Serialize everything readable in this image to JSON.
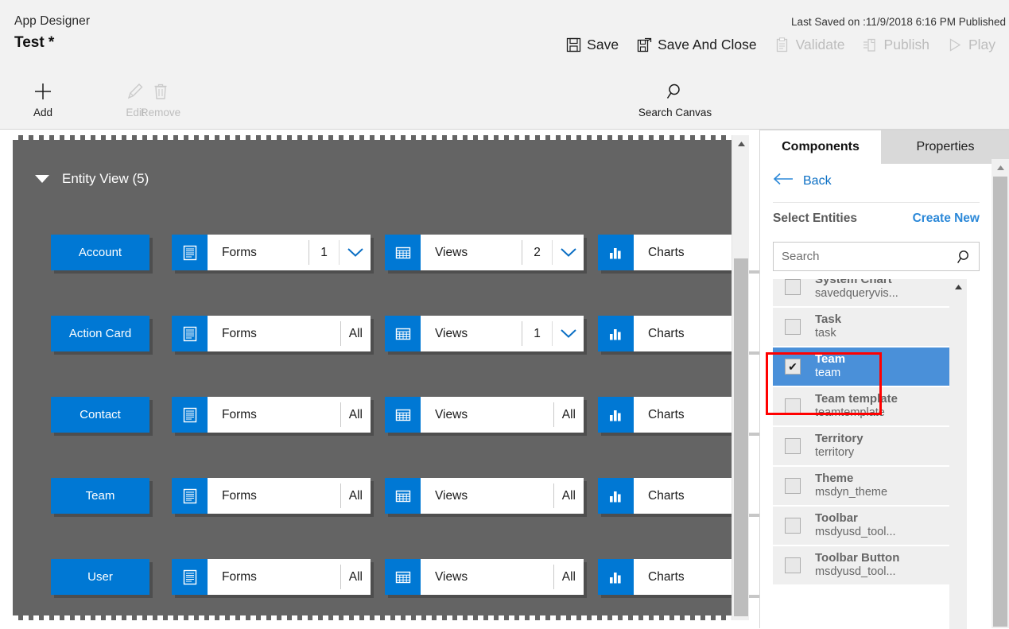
{
  "header": {
    "app_designer_label": "App Designer",
    "app_name": "Test *",
    "last_saved": "Last Saved on :11/9/2018 6:16 PM Published",
    "commands": [
      {
        "label": "Save",
        "icon": "save-icon",
        "disabled": false
      },
      {
        "label": "Save And Close",
        "icon": "save-and-close-icon",
        "disabled": false
      },
      {
        "label": "Validate",
        "icon": "validate-icon",
        "disabled": true
      },
      {
        "label": "Publish",
        "icon": "publish-icon",
        "disabled": true
      },
      {
        "label": "Play",
        "icon": "play-icon",
        "disabled": true
      }
    ]
  },
  "ribbon": {
    "add_label": "Add",
    "edit_label": "Edit",
    "remove_label": "Remove",
    "search_canvas_label": "Search Canvas"
  },
  "canvas": {
    "section_title": "Entity View (5)",
    "forms_label": "Forms",
    "views_label": "Views",
    "charts_label": "Charts",
    "rows": [
      {
        "entity": "Account",
        "forms_count": "1",
        "forms_has_chevron": true,
        "views_count": "2",
        "views_has_chevron": true,
        "charts_count": ""
      },
      {
        "entity": "Action Card",
        "forms_count": "All",
        "forms_has_chevron": false,
        "views_count": "1",
        "views_has_chevron": true,
        "charts_count": ""
      },
      {
        "entity": "Contact",
        "forms_count": "All",
        "forms_has_chevron": false,
        "views_count": "All",
        "views_has_chevron": false,
        "charts_count": ""
      },
      {
        "entity": "Team",
        "forms_count": "All",
        "forms_has_chevron": false,
        "views_count": "All",
        "views_has_chevron": false,
        "charts_count": ""
      },
      {
        "entity": "User",
        "forms_count": "All",
        "forms_has_chevron": false,
        "views_count": "All",
        "views_has_chevron": false,
        "charts_count": ""
      }
    ]
  },
  "panel": {
    "tab_components": "Components",
    "tab_properties": "Properties",
    "back_label": "Back",
    "select_entities_label": "Select Entities",
    "create_new_label": "Create New",
    "search_placeholder": "Search",
    "search_value": "",
    "entities": [
      {
        "display": "System Chart",
        "logical": "savedqueryvis...",
        "checked": false,
        "selected": false
      },
      {
        "display": "Task",
        "logical": "task",
        "checked": false,
        "selected": false
      },
      {
        "display": "Team",
        "logical": "team",
        "checked": true,
        "selected": true
      },
      {
        "display": "Team template",
        "logical": "teamtemplate",
        "checked": false,
        "selected": false
      },
      {
        "display": "Territory",
        "logical": "territory",
        "checked": false,
        "selected": false
      },
      {
        "display": "Theme",
        "logical": "msdyn_theme",
        "checked": false,
        "selected": false
      },
      {
        "display": "Toolbar",
        "logical": "msdyusd_tool...",
        "checked": false,
        "selected": false
      },
      {
        "display": "Toolbar Button",
        "logical": "msdyusd_tool...",
        "checked": false,
        "selected": false
      }
    ],
    "checkbox_glyph": "✔"
  },
  "colors": {
    "accent_blue": "#0078d4",
    "selected_row_blue": "#4a90d9",
    "canvas_gray": "#646464",
    "chrome_gray": "#f2f2f2",
    "link_blue": "#2b88d8",
    "annotation_red": "#ff0000"
  }
}
